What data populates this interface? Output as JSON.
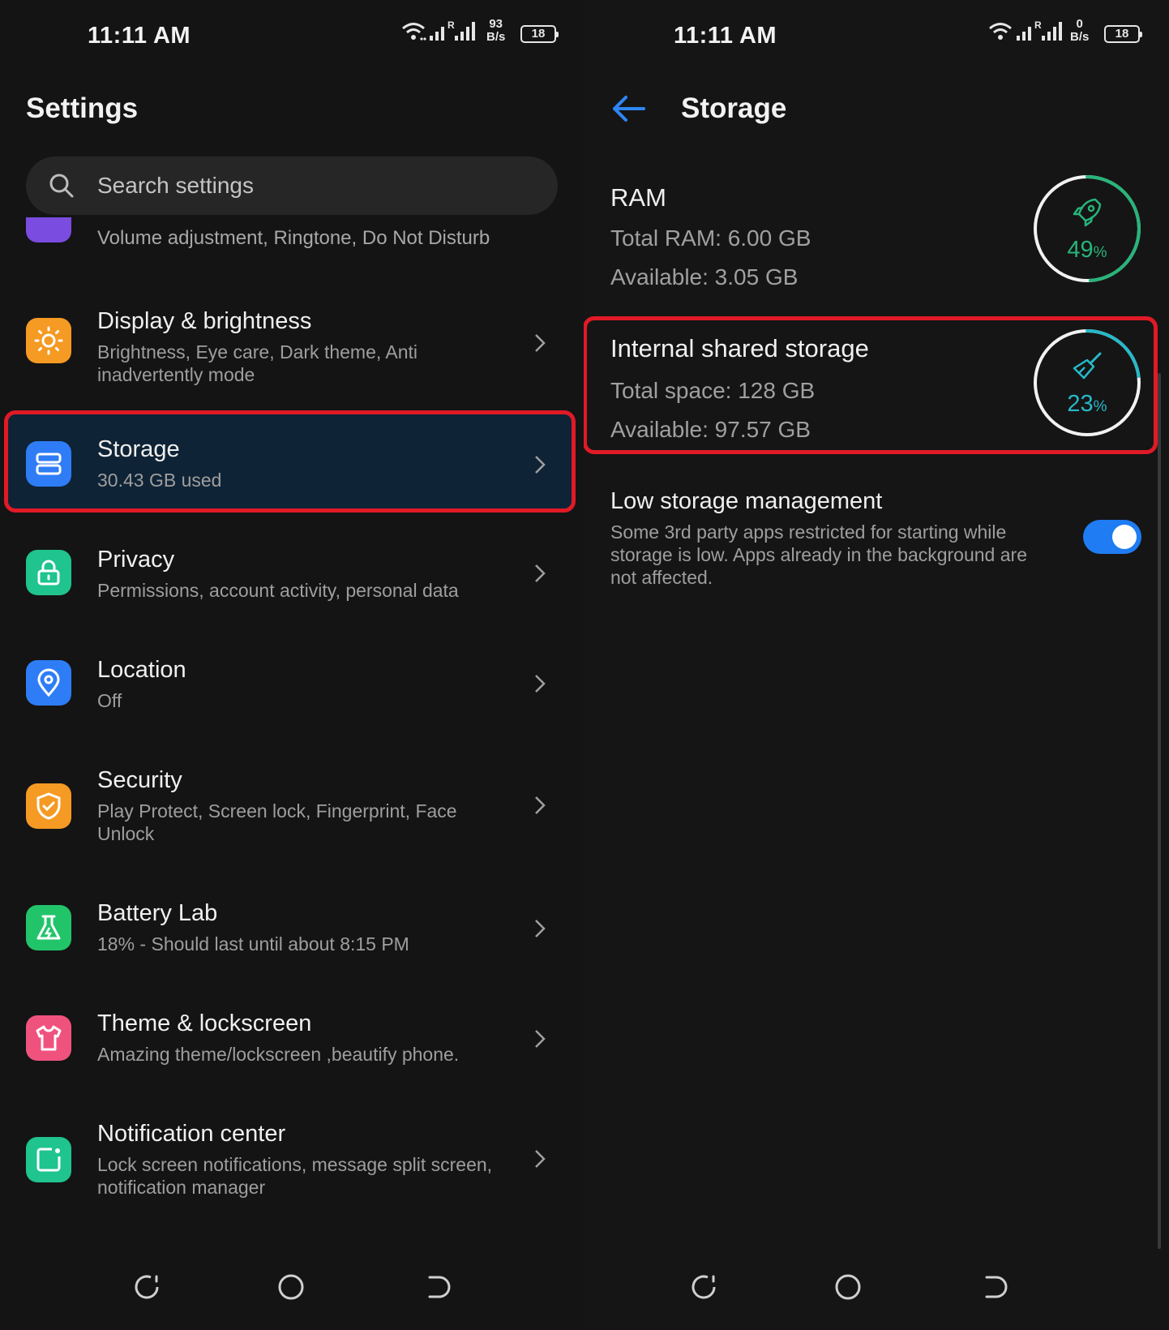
{
  "left": {
    "status": {
      "time": "11:11 AM",
      "net_speed_value": "93",
      "net_speed_unit": "B/s",
      "roaming": "R",
      "battery": "18"
    },
    "title": "Settings",
    "search": {
      "placeholder": "Search settings"
    },
    "partial_item": {
      "subtitle": "Volume adjustment, Ringtone, Do Not Disturb"
    },
    "items": [
      {
        "title": "Display & brightness",
        "subtitle": "Brightness, Eye care, Dark theme, Anti inadvertently mode",
        "icon": "sun-icon",
        "color": "#f59a23"
      },
      {
        "title": "Storage",
        "subtitle": "30.43 GB used",
        "icon": "storage-icon",
        "color": "#2f7df6",
        "highlighted": true
      },
      {
        "title": "Privacy",
        "subtitle": "Permissions, account activity, personal data",
        "icon": "lock-icon",
        "color": "#1fc48e"
      },
      {
        "title": "Location",
        "subtitle": "Off",
        "icon": "location-pin-icon",
        "color": "#2f7df6"
      },
      {
        "title": "Security",
        "subtitle": "Play Protect, Screen lock, Fingerprint, Face Unlock",
        "icon": "shield-icon",
        "color": "#f59a23"
      },
      {
        "title": "Battery Lab",
        "subtitle": "18% - Should last until about 8:15 PM",
        "icon": "flask-icon",
        "color": "#22c46a"
      },
      {
        "title": "Theme & lockscreen",
        "subtitle": "Amazing theme/lockscreen ,beautify phone.",
        "icon": "shirt-icon",
        "color": "#f0527e"
      },
      {
        "title": "Notification center",
        "subtitle": "Lock screen notifications, message split screen, notification manager",
        "icon": "notification-icon",
        "color": "#1fc48e"
      }
    ]
  },
  "right": {
    "status": {
      "time": "11:11 AM",
      "net_speed_value": "0",
      "net_speed_unit": "B/s",
      "roaming": "R",
      "battery": "18"
    },
    "title": "Storage",
    "ram": {
      "title": "RAM",
      "total": "Total RAM: 6.00 GB",
      "available": "Available: 3.05 GB",
      "percent": "49",
      "percent_value": 0.49,
      "unit": "%",
      "color": "#27b47a"
    },
    "internal": {
      "title": "Internal shared storage",
      "total": "Total space: 128 GB",
      "available": "Available: 97.57 GB",
      "percent": "23",
      "percent_value": 0.23,
      "unit": "%",
      "color": "#27b8c9"
    },
    "low_storage": {
      "title": "Low storage management",
      "description": "Some 3rd party apps restricted for starting while storage is low. Apps already in the background are not affected.",
      "enabled": true
    }
  },
  "colors": {
    "highlight": "#e01a26",
    "accent": "#1f7cf2"
  }
}
